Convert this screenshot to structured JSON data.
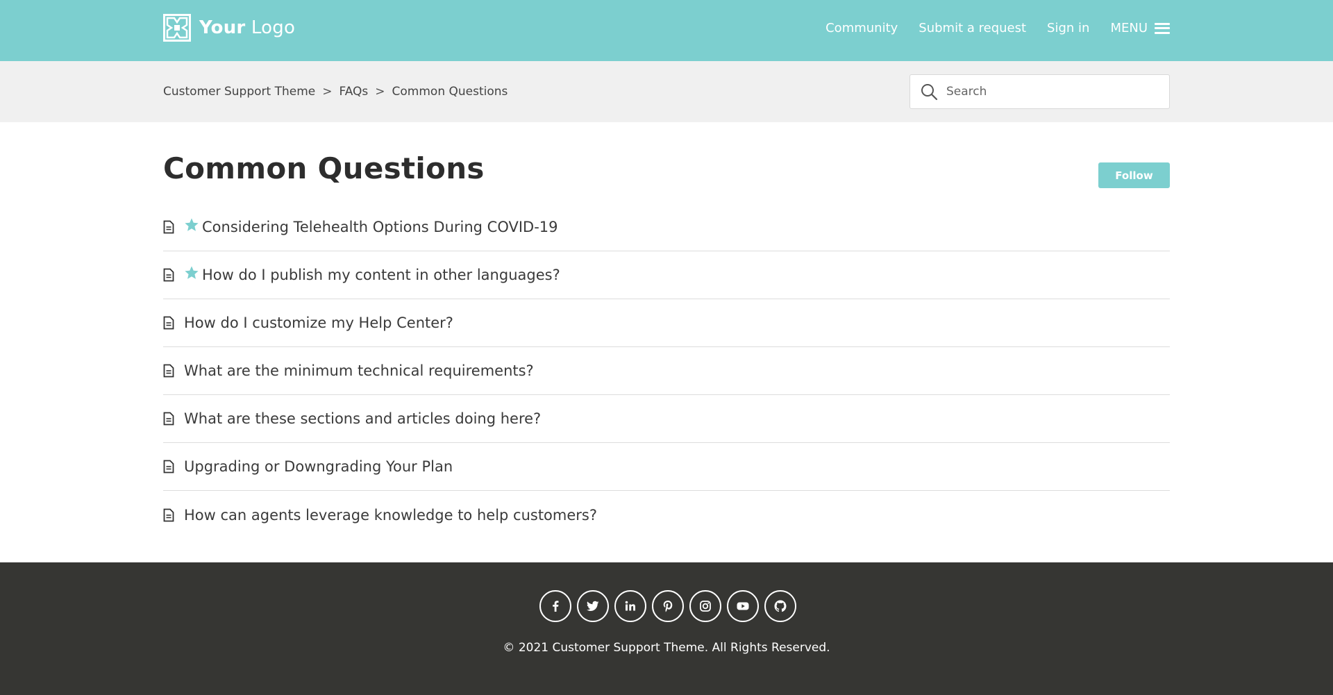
{
  "header": {
    "logo_bold": "Your",
    "logo_light": "Logo",
    "nav": {
      "community": "Community",
      "submit_request": "Submit a request",
      "sign_in": "Sign in",
      "menu": "MENU"
    },
    "bg_color": "#7ccfcf"
  },
  "breadcrumbs": {
    "items": [
      "Customer Support Theme",
      "FAQs",
      "Common Questions"
    ],
    "separator": ">"
  },
  "search": {
    "placeholder": "Search",
    "icon": "search-icon"
  },
  "section": {
    "title": "Common Questions",
    "follow_label": "Follow",
    "articles": [
      {
        "title": "Considering Telehealth Options During COVID-19",
        "promoted": true
      },
      {
        "title": "How do I publish my content in other languages?",
        "promoted": true
      },
      {
        "title": "How do I customize my Help Center?",
        "promoted": false
      },
      {
        "title": "What are the minimum technical requirements?",
        "promoted": false
      },
      {
        "title": "What are these sections and articles doing here?",
        "promoted": false
      },
      {
        "title": "Upgrading or Downgrading Your Plan",
        "promoted": false
      },
      {
        "title": "How can agents leverage knowledge to help customers?",
        "promoted": false
      }
    ]
  },
  "footer": {
    "socials": [
      "facebook-icon",
      "twitter-icon",
      "linkedin-icon",
      "pinterest-icon",
      "instagram-icon",
      "youtube-icon",
      "github-icon"
    ],
    "copyright": "© 2021 Customer Support Theme. All Rights Reserved.",
    "bg_color": "#363633"
  },
  "accent_color": "#7ccfcf"
}
